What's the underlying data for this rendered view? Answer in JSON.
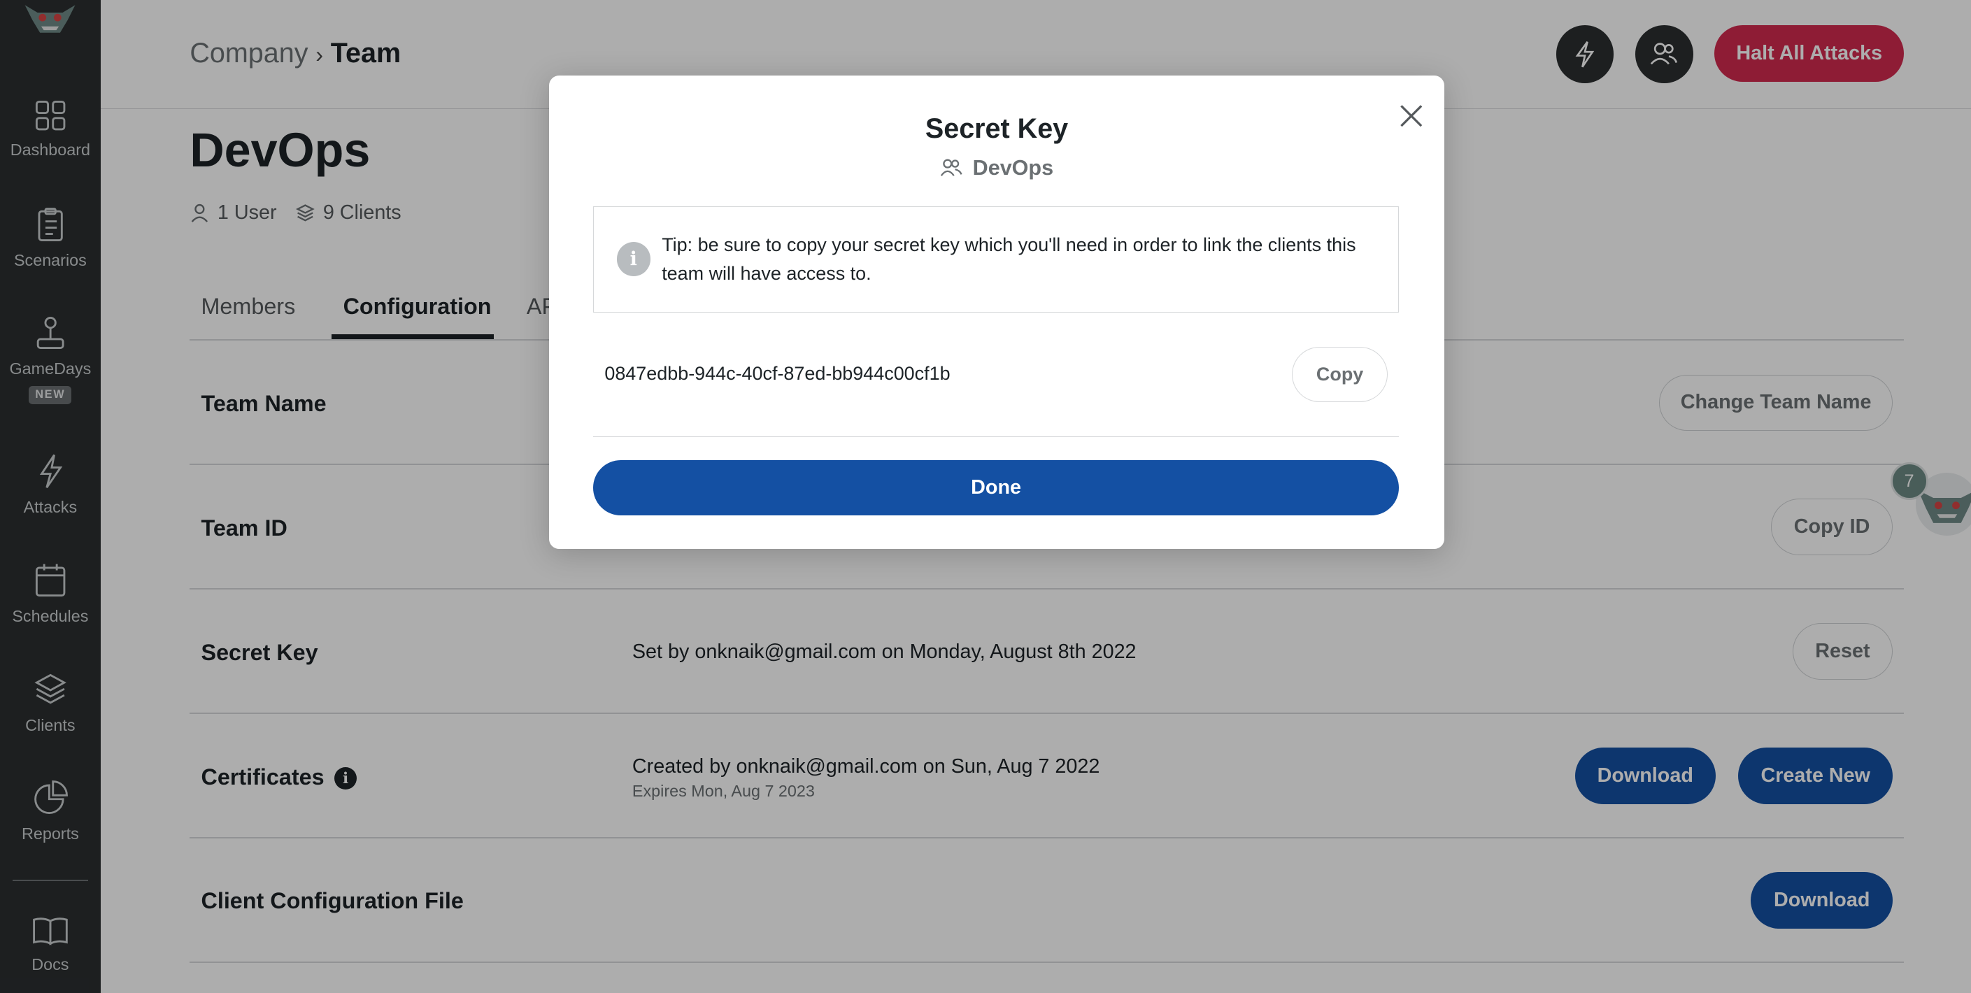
{
  "sidebar": {
    "items": [
      {
        "label": "Dashboard",
        "icon": "dashboard-icon"
      },
      {
        "label": "Scenarios",
        "icon": "clipboard-icon"
      },
      {
        "label": "GameDays",
        "icon": "joystick-icon",
        "badge": "NEW"
      },
      {
        "label": "Attacks",
        "icon": "lightning-icon"
      },
      {
        "label": "Schedules",
        "icon": "calendar-icon"
      },
      {
        "label": "Clients",
        "icon": "layers-icon"
      },
      {
        "label": "Reports",
        "icon": "pie-chart-icon"
      },
      {
        "label": "Docs",
        "icon": "book-icon"
      }
    ]
  },
  "header": {
    "breadcrumb_parent": "Company",
    "breadcrumb_current": "Team",
    "halt_label": "Halt All Attacks"
  },
  "page": {
    "title": "DevOps",
    "users": "1 User",
    "clients": "9 Clients",
    "tabs": [
      "Members",
      "Configuration",
      "AP"
    ]
  },
  "rows": {
    "team_name": {
      "label": "Team Name",
      "button": "Change Team Name"
    },
    "team_id": {
      "label": "Team ID",
      "button": "Copy ID"
    },
    "secret_key": {
      "label": "Secret Key",
      "text": "Set by onknaik@gmail.com on Monday, August 8th 2022",
      "button": "Reset"
    },
    "certificates": {
      "label": "Certificates",
      "text": "Created by onknaik@gmail.com on Sun, Aug 7 2022",
      "subtext": "Expires Mon, Aug 7 2023",
      "download": "Download",
      "create": "Create New"
    },
    "client_config": {
      "label": "Client Configuration File",
      "download": "Download"
    }
  },
  "helper": {
    "count": "7"
  },
  "modal": {
    "title": "Secret Key",
    "subtitle": "DevOps",
    "tip": "Tip: be sure to copy your secret key which you'll need in order to link the clients this team will have access to.",
    "secret_value": "0847edbb-944c-40cf-87ed-bb944c00cf1b",
    "copy_label": "Copy",
    "done_label": "Done"
  },
  "colors": {
    "accent_blue": "#1450a3",
    "halt_red": "#d12a4f",
    "sidebar_bg": "#2b2e30"
  }
}
